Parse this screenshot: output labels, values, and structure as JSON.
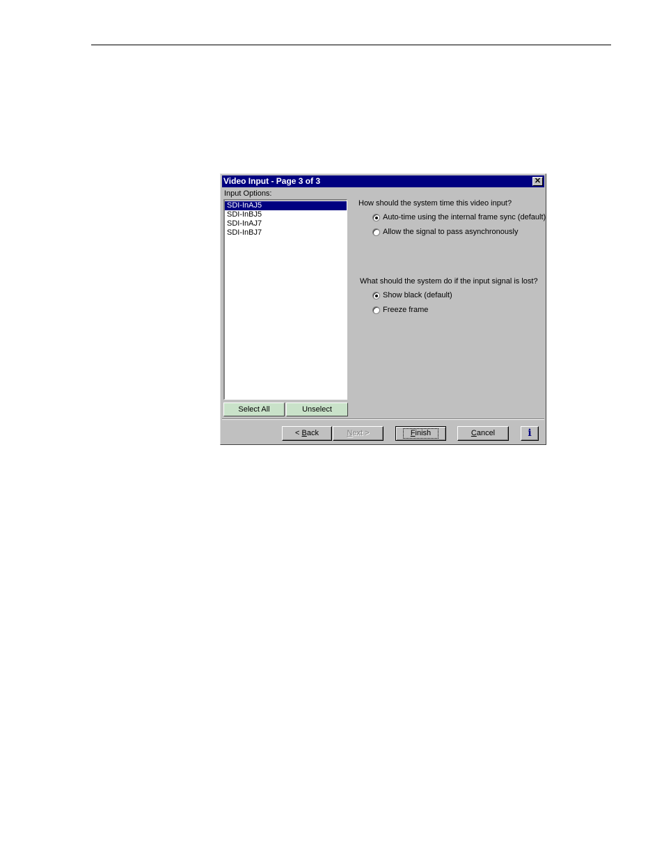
{
  "window": {
    "title": "Video Input - Page 3 of 3",
    "close_glyph": "✕"
  },
  "input_options": {
    "label": "Input Options:",
    "items": [
      "SDI-InAJ5",
      "SDI-InBJ5",
      "SDI-InAJ7",
      "SDI-InBJ7"
    ],
    "selected_index": 0,
    "select_all_label": "Select All",
    "unselect_label": "Unselect"
  },
  "timing": {
    "question": "How should the system time this video input?",
    "options": [
      {
        "label": "Auto-time using the internal frame sync (default)",
        "checked": true
      },
      {
        "label": "Allow the signal to pass asynchronously",
        "checked": false
      }
    ]
  },
  "signal_loss": {
    "question": "What should the system do if the input signal is lost?",
    "options": [
      {
        "label": "Show black (default)",
        "checked": true
      },
      {
        "label": "Freeze frame",
        "checked": false
      }
    ]
  },
  "buttons": {
    "back": {
      "prefix": "< ",
      "accel": "B",
      "rest": "ack",
      "enabled": true
    },
    "next": {
      "accel": "N",
      "rest": "ext",
      "suffix": " >",
      "enabled": false
    },
    "finish": {
      "accel": "F",
      "rest": "inish",
      "enabled": true
    },
    "cancel": {
      "accel": "C",
      "rest": "ancel",
      "enabled": true
    },
    "info": "i"
  },
  "icons": {
    "close": "close-icon",
    "info": "info-icon"
  }
}
